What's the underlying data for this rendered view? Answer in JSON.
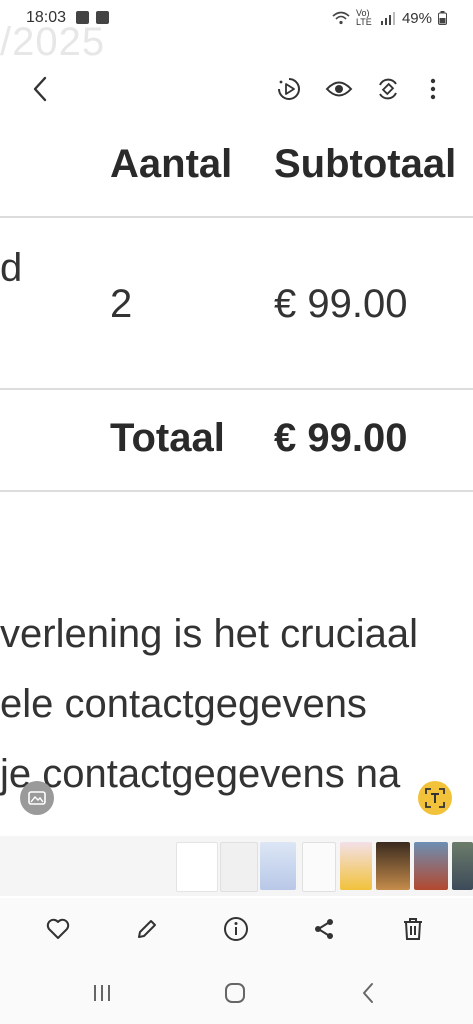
{
  "status_bar": {
    "time": "18:03",
    "network": "Vo) LTE",
    "battery": "49%"
  },
  "background_date": "/2025",
  "receipt": {
    "headers": {
      "quantity": "Aantal",
      "subtotal": "Subtotaal"
    },
    "row": {
      "name_fragment": "d",
      "quantity": "2",
      "subtotal": "€ 99.00"
    },
    "total": {
      "label": "Totaal",
      "value": "€ 99.00"
    },
    "paragraph": [
      "verlening is het cruciaal",
      "ele contactgegevens",
      "je contactgegevens na"
    ]
  },
  "icons": {
    "back": "back-arrow-icon",
    "remaster": "play-enhance-icon",
    "view": "eye-icon",
    "rotate": "rotate-icon",
    "more": "more-vertical-icon",
    "favorite": "heart-icon",
    "edit": "pencil-icon",
    "info": "info-icon",
    "share": "share-icon",
    "delete": "trash-icon"
  },
  "colors": {
    "accent": "#f2c23a",
    "text": "#333333",
    "rule": "#dcdcdc"
  }
}
